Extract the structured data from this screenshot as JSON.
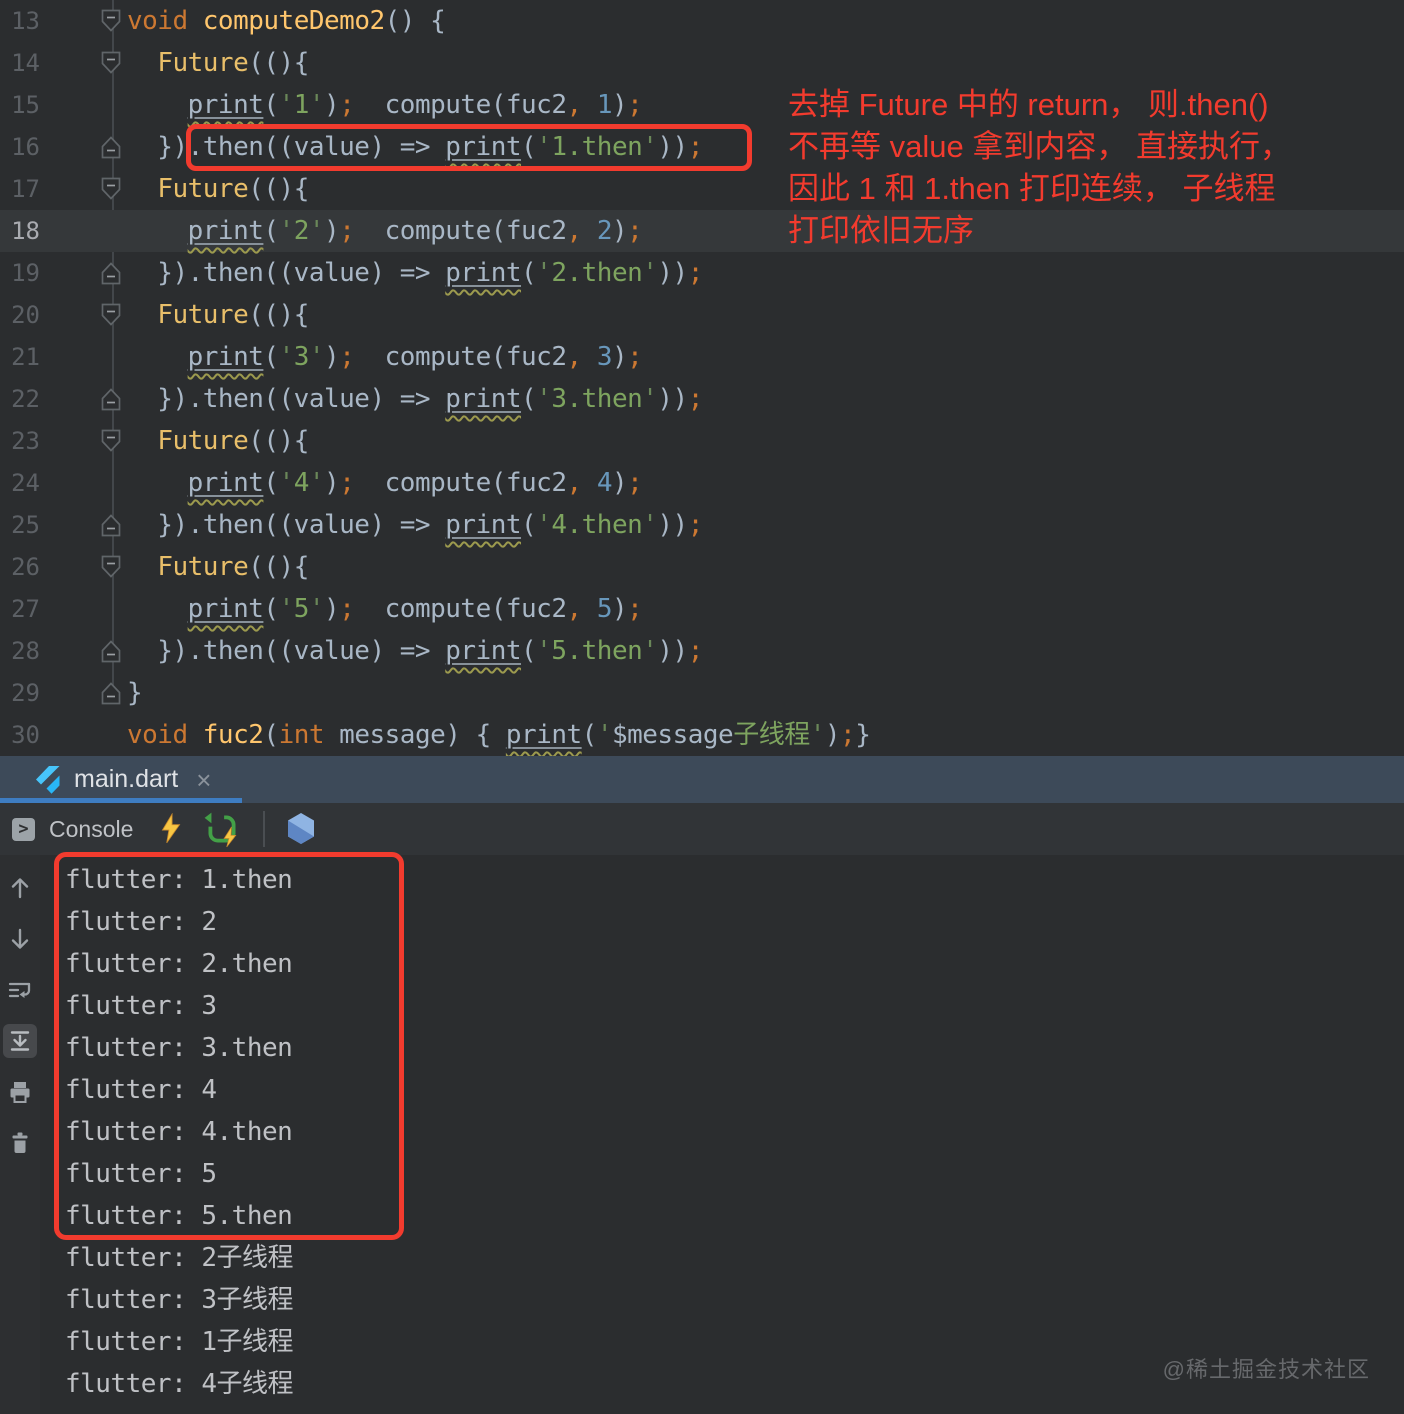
{
  "tab": {
    "label": "main.dart",
    "close": "×"
  },
  "toolbar": {
    "console_label": "Console"
  },
  "colors": {
    "annotation_red": "#F23B2E",
    "tab_underline_blue": "#3E7DC2",
    "keyword_orange": "#CC7832",
    "function_yellow": "#FFC66D",
    "string_green": "#6A8759",
    "number_blue": "#6897BB",
    "hot_reload_yellow": "#F7C643",
    "hot_restart_green": "#43A047"
  },
  "editor": {
    "lines": [
      {
        "num": "13",
        "fold": "down",
        "tokens": [
          [
            "void ",
            "kw"
          ],
          [
            "computeDemo2",
            "fn"
          ],
          [
            "() {",
            "pl"
          ]
        ]
      },
      {
        "num": "14",
        "fold": "down",
        "tokens": [
          [
            "  ",
            "pl"
          ],
          [
            "Future",
            "cls"
          ],
          [
            "((){",
            "pl"
          ]
        ]
      },
      {
        "num": "15",
        "fold": null,
        "tokens": [
          [
            "    ",
            "pl"
          ],
          [
            "print",
            "pr"
          ],
          [
            "(",
            "pl"
          ],
          [
            "'",
            "str"
          ],
          [
            "1",
            "strb"
          ],
          [
            "'",
            "str"
          ],
          [
            ")",
            "pl"
          ],
          [
            ";",
            "sc"
          ],
          [
            "  compute(fuc2",
            "pl"
          ],
          [
            ",",
            "sc"
          ],
          [
            " ",
            "pl"
          ],
          [
            "1",
            "num"
          ],
          [
            ")",
            "pl"
          ],
          [
            ";",
            "sc"
          ]
        ]
      },
      {
        "num": "16",
        "fold": "up",
        "tokens": [
          [
            "  })",
            "pl"
          ],
          [
            ".then((value) => ",
            "pl"
          ],
          [
            "print",
            "pr"
          ],
          [
            "(",
            "pl"
          ],
          [
            "'",
            "str"
          ],
          [
            "1.then",
            "strb"
          ],
          [
            "'",
            "str"
          ],
          [
            "))",
            "pl"
          ],
          [
            ";",
            "sc"
          ]
        ]
      },
      {
        "num": "17",
        "fold": "down",
        "tokens": [
          [
            "  ",
            "pl"
          ],
          [
            "Future",
            "cls"
          ],
          [
            "((){",
            "pl"
          ]
        ]
      },
      {
        "num": "18",
        "fold": null,
        "hl": true,
        "tokens": [
          [
            "    ",
            "pl"
          ],
          [
            "print",
            "pr"
          ],
          [
            "(",
            "pl"
          ],
          [
            "'",
            "str"
          ],
          [
            "2",
            "strb"
          ],
          [
            "'",
            "str"
          ],
          [
            ")",
            "pl"
          ],
          [
            ";",
            "sc"
          ],
          [
            "  compute(fuc2",
            "pl"
          ],
          [
            ",",
            "sc"
          ],
          [
            " ",
            "pl"
          ],
          [
            "2",
            "num"
          ],
          [
            ")",
            "pl"
          ],
          [
            ";",
            "sc"
          ]
        ]
      },
      {
        "num": "19",
        "fold": "up",
        "tokens": [
          [
            "  }).then((value) => ",
            "pl"
          ],
          [
            "print",
            "pr"
          ],
          [
            "(",
            "pl"
          ],
          [
            "'",
            "str"
          ],
          [
            "2.then",
            "strb"
          ],
          [
            "'",
            "str"
          ],
          [
            "))",
            "pl"
          ],
          [
            ";",
            "sc"
          ]
        ]
      },
      {
        "num": "20",
        "fold": "down",
        "tokens": [
          [
            "  ",
            "pl"
          ],
          [
            "Future",
            "cls"
          ],
          [
            "((){",
            "pl"
          ]
        ]
      },
      {
        "num": "21",
        "fold": null,
        "tokens": [
          [
            "    ",
            "pl"
          ],
          [
            "print",
            "pr"
          ],
          [
            "(",
            "pl"
          ],
          [
            "'",
            "str"
          ],
          [
            "3",
            "strb"
          ],
          [
            "'",
            "str"
          ],
          [
            ")",
            "pl"
          ],
          [
            ";",
            "sc"
          ],
          [
            "  compute(fuc2",
            "pl"
          ],
          [
            ",",
            "sc"
          ],
          [
            " ",
            "pl"
          ],
          [
            "3",
            "num"
          ],
          [
            ")",
            "pl"
          ],
          [
            ";",
            "sc"
          ]
        ]
      },
      {
        "num": "22",
        "fold": "up",
        "tokens": [
          [
            "  }).then((value) => ",
            "pl"
          ],
          [
            "print",
            "pr"
          ],
          [
            "(",
            "pl"
          ],
          [
            "'",
            "str"
          ],
          [
            "3.then",
            "strb"
          ],
          [
            "'",
            "str"
          ],
          [
            "))",
            "pl"
          ],
          [
            ";",
            "sc"
          ]
        ]
      },
      {
        "num": "23",
        "fold": "down",
        "tokens": [
          [
            "  ",
            "pl"
          ],
          [
            "Future",
            "cls"
          ],
          [
            "((){",
            "pl"
          ]
        ]
      },
      {
        "num": "24",
        "fold": null,
        "tokens": [
          [
            "    ",
            "pl"
          ],
          [
            "print",
            "pr"
          ],
          [
            "(",
            "pl"
          ],
          [
            "'",
            "str"
          ],
          [
            "4",
            "strb"
          ],
          [
            "'",
            "str"
          ],
          [
            ")",
            "pl"
          ],
          [
            ";",
            "sc"
          ],
          [
            "  compute(fuc2",
            "pl"
          ],
          [
            ",",
            "sc"
          ],
          [
            " ",
            "pl"
          ],
          [
            "4",
            "num"
          ],
          [
            ")",
            "pl"
          ],
          [
            ";",
            "sc"
          ]
        ]
      },
      {
        "num": "25",
        "fold": "up",
        "tokens": [
          [
            "  }).then((value) => ",
            "pl"
          ],
          [
            "print",
            "pr"
          ],
          [
            "(",
            "pl"
          ],
          [
            "'",
            "str"
          ],
          [
            "4.then",
            "strb"
          ],
          [
            "'",
            "str"
          ],
          [
            "))",
            "pl"
          ],
          [
            ";",
            "sc"
          ]
        ]
      },
      {
        "num": "26",
        "fold": "down",
        "tokens": [
          [
            "  ",
            "pl"
          ],
          [
            "Future",
            "cls"
          ],
          [
            "((){",
            "pl"
          ]
        ]
      },
      {
        "num": "27",
        "fold": null,
        "tokens": [
          [
            "    ",
            "pl"
          ],
          [
            "print",
            "pr"
          ],
          [
            "(",
            "pl"
          ],
          [
            "'",
            "str"
          ],
          [
            "5",
            "strb"
          ],
          [
            "'",
            "str"
          ],
          [
            ")",
            "pl"
          ],
          [
            ";",
            "sc"
          ],
          [
            "  compute(fuc2",
            "pl"
          ],
          [
            ",",
            "sc"
          ],
          [
            " ",
            "pl"
          ],
          [
            "5",
            "num"
          ],
          [
            ")",
            "pl"
          ],
          [
            ";",
            "sc"
          ]
        ]
      },
      {
        "num": "28",
        "fold": "up",
        "tokens": [
          [
            "  }).then((value) => ",
            "pl"
          ],
          [
            "print",
            "pr"
          ],
          [
            "(",
            "pl"
          ],
          [
            "'",
            "str"
          ],
          [
            "5.then",
            "strb"
          ],
          [
            "'",
            "str"
          ],
          [
            "))",
            "pl"
          ],
          [
            ";",
            "sc"
          ]
        ]
      },
      {
        "num": "29",
        "fold": "up",
        "tokens": [
          [
            "}",
            "pl"
          ]
        ]
      },
      {
        "num": "30",
        "fold": null,
        "tokens": [
          [
            "void ",
            "kw"
          ],
          [
            "fuc2",
            "fn"
          ],
          [
            "(",
            "pl"
          ],
          [
            "int",
            "kw"
          ],
          [
            " message) { ",
            "pl"
          ],
          [
            "print",
            "pr"
          ],
          [
            "(",
            "pl"
          ],
          [
            "'",
            "str"
          ],
          [
            "$message",
            "pl"
          ],
          [
            "子线程",
            "strb"
          ],
          [
            "'",
            "str"
          ],
          [
            ")",
            "pl"
          ],
          [
            ";",
            "sc"
          ],
          [
            "}",
            "pl"
          ]
        ]
      }
    ]
  },
  "annotation": {
    "lines": [
      "去掉 Future 中的 return， 则.then()",
      "不再等 value 拿到内容， 直接执行，",
      "因此 1 和 1.then 打印连续， 子线程",
      "打印依旧无序"
    ]
  },
  "console": {
    "lines": [
      "flutter: 1.then",
      "flutter: 2",
      "flutter: 2.then",
      "flutter: 3",
      "flutter: 3.then",
      "flutter: 4",
      "flutter: 4.then",
      "flutter: 5",
      "flutter: 5.then",
      "flutter: 2子线程",
      "flutter: 3子线程",
      "flutter: 1子线程",
      "flutter: 4子线程"
    ],
    "boxed_count": 9
  },
  "watermark": "@稀土掘金技术社区"
}
